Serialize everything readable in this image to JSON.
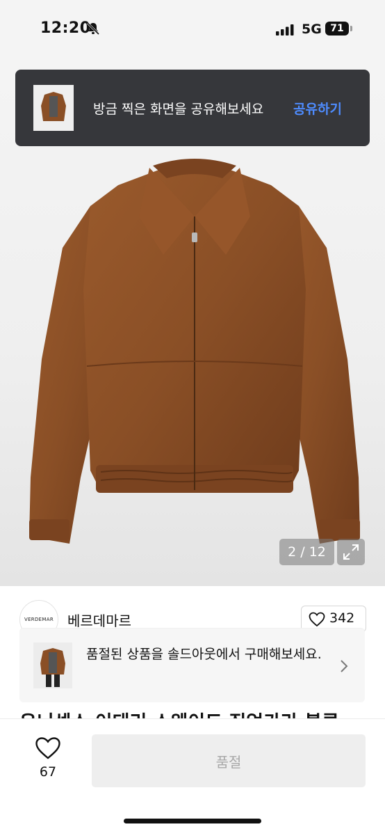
{
  "status_bar": {
    "time": "12:20",
    "network": "5G",
    "battery": "71"
  },
  "toast": {
    "message": "방금 찍은 화면을 공유해보세요",
    "action": "공유하기"
  },
  "gallery": {
    "counter": "2 / 12"
  },
  "seller": {
    "logo_text": "VERDEMAR",
    "name": "베르데마르"
  },
  "likes": {
    "count": "342"
  },
  "sold_out_banner": {
    "text": "품절된 상품을 솔드아웃에서 구매해보세요."
  },
  "product": {
    "title": "유니섹스 이태리 스웨이드 집업카라 블루"
  },
  "bottom_bar": {
    "wish_count": "67",
    "buy_label": "품절"
  },
  "colors": {
    "jacket": "#8a4f26",
    "toast_bg": "#36373b",
    "toast_link": "#4e8cff"
  },
  "icons": [
    "bell-slash-icon",
    "signal-icon",
    "expand-icon",
    "heart-icon",
    "chevron-right-icon"
  ]
}
